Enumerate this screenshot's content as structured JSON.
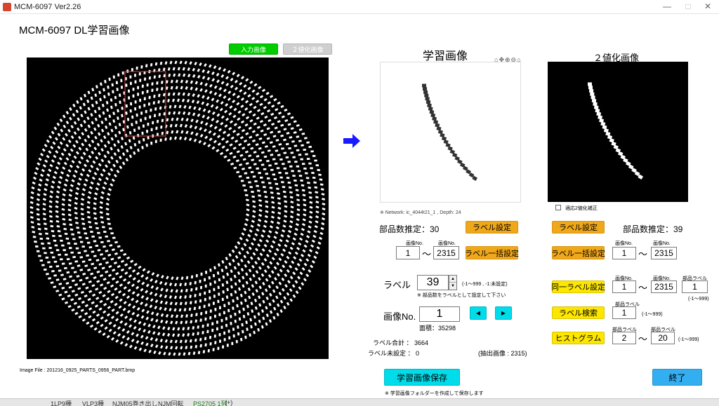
{
  "window": {
    "title": "MCM-6097 Ver2.26"
  },
  "app_title": "MCM-6097  DL学習画像",
  "view_toggle": {
    "input_label": "入力画像",
    "binary_label": "２値化画像"
  },
  "left_image": {
    "file_label": "Image File : 201216_0925_PARTS_0956_PART.bmp"
  },
  "learning": {
    "title": "学習画像",
    "network_info": "※ Network: ic_4044t21_1 , Depth: 24",
    "parts_estimate": "部品数推定：30",
    "label_setting_btn": "ラベル設定",
    "img_no_from_cap": "画像No.",
    "img_no_to_cap": "画像No.",
    "img_no_from": "1",
    "tilde": "～",
    "img_no_to": "2315",
    "label_bulk_btn": "ラベル一括設定",
    "label_title": "ラベル",
    "label_value": "39",
    "label_range_note": "(-1～999 , -1:未設定)",
    "label_note": "※ 部品数をラベルとして設定して下さい",
    "image_no_title": "画像No.",
    "image_no_value": "1",
    "area": "面積：35298",
    "label_total": "ラベル合計 ： 3664",
    "label_unset": "ラベル未設定 ： 0",
    "extracted": "(抽出画像 : 2315)",
    "save_btn": "学習画像保存",
    "save_note": "※ 学習画像フォルダーを作成して保存します"
  },
  "binary": {
    "title": "２値化画像",
    "adaptive_label": "適応2値化補正",
    "label_setting_btn": "ラベル設定",
    "parts_estimate": "部品数推定：39",
    "img_no_from_cap": "画像No.",
    "img_no_to_cap": "画像No.",
    "img_no_from": "1",
    "tilde": "～",
    "img_no_to": "2315",
    "label_bulk_btn": "ラベル一括設定",
    "same_label_btn": "同一ラベル設定",
    "same_from_cap": "画像No.",
    "same_to_cap": "画像No.",
    "same_label_cap": "部品ラベル",
    "same_from": "1",
    "same_to": "2315",
    "same_label": "1",
    "same_label_range": "(-1～999)",
    "search_btn": "ラベル検索",
    "search_cap": "部品ラベル",
    "search_value": "1",
    "search_range": "(-1～999)",
    "histogram_btn": "ヒストグラム",
    "hist_from_cap": "部品ラベル",
    "hist_to_cap": "部品ラベル",
    "hist_from": "2",
    "hist_to": "20",
    "hist_range": "(-1～999)"
  },
  "exit_btn": "終了",
  "taskbar": {
    "tabs": [
      "1LP9種",
      "VLP3種",
      "NJM05巻き出し",
      "NJM回転",
      "PS2705 1列",
      "(+)"
    ]
  },
  "colors": {
    "orange": "#f0a81b",
    "yellow": "#fde600",
    "cyan": "#00dcea",
    "green": "#00cc00",
    "blue_arrow": "#1a1aff"
  }
}
